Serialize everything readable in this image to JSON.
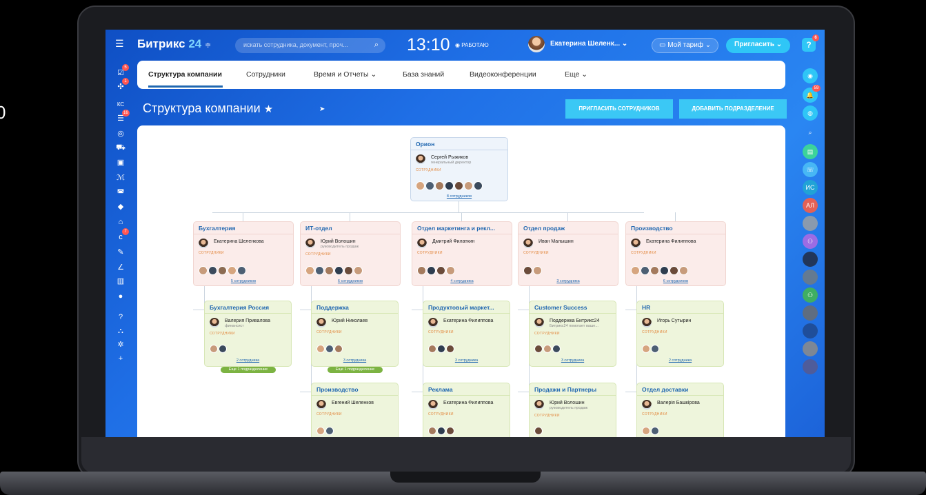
{
  "edge_char": "0",
  "topbar": {
    "logo_name": "Битрикс",
    "logo_num": "24",
    "logo_suffix": "≑",
    "search_placeholder": "искать сотрудника, документ, проч...",
    "time": "13:10",
    "work_status": "◉ РАБОТАЮ",
    "user_name": "Екатерина Шеленк... ⌄",
    "tariff_label": "Мой тариф",
    "invite_label": "Пригласить",
    "help_label": "?",
    "help_badge": "6"
  },
  "left_sidebar": {
    "items": [
      {
        "icon": "checkbox-icon",
        "glyph": "☑",
        "badge": "5"
      },
      {
        "icon": "chat-icon",
        "glyph": "✣",
        "badge": "1"
      },
      {
        "icon": "kc-icon",
        "glyph": "КС",
        "badge": ""
      },
      {
        "icon": "filter-icon",
        "glyph": "☰",
        "badge": "16"
      },
      {
        "icon": "target-icon",
        "glyph": "◎",
        "badge": ""
      },
      {
        "icon": "cart-icon",
        "glyph": "⛟",
        "badge": ""
      },
      {
        "icon": "contacts-icon",
        "glyph": "▣",
        "badge": ""
      },
      {
        "icon": "sites-icon",
        "glyph": "ℳ",
        "badge": ""
      },
      {
        "icon": "robot-icon",
        "glyph": "◚",
        "badge": ""
      },
      {
        "icon": "box-icon",
        "glyph": "◆",
        "badge": ""
      },
      {
        "icon": "building-icon",
        "glyph": "⌂",
        "badge": ""
      },
      {
        "icon": "calendar-icon",
        "glyph": "c",
        "badge": "7"
      },
      {
        "icon": "tasks-icon",
        "glyph": "✎",
        "badge": ""
      },
      {
        "icon": "sign-icon",
        "glyph": "∠",
        "badge": ""
      },
      {
        "icon": "analytics-icon",
        "glyph": "▥",
        "badge": ""
      },
      {
        "icon": "more-icon",
        "glyph": "●",
        "badge": ""
      },
      {
        "icon": "question-icon",
        "glyph": "?",
        "badge": ""
      },
      {
        "icon": "structure-icon",
        "glyph": "⛬",
        "badge": ""
      },
      {
        "icon": "settings-icon",
        "glyph": "✲",
        "badge": ""
      },
      {
        "icon": "plus-icon",
        "glyph": "+",
        "badge": ""
      }
    ]
  },
  "right_sidebar": {
    "items": [
      {
        "icon": "copilot-icon",
        "glyph": "◉",
        "badge": "",
        "color": "#2fc6f6"
      },
      {
        "icon": "bell-icon",
        "glyph": "🔔",
        "badge": "59",
        "color": "#2fc6f6"
      },
      {
        "icon": "chat-bubble-icon",
        "glyph": "◍",
        "badge": "",
        "color": "#2fc6f6"
      },
      {
        "icon": "search-icon",
        "glyph": "⌕",
        "badge": "",
        "color": "transparent"
      },
      {
        "icon": "green-chat-icon",
        "glyph": "▤",
        "badge": "",
        "color": "#3cd39b"
      },
      {
        "icon": "openlines-icon",
        "glyph": "☏",
        "badge": "",
        "color": "#47b7f5"
      },
      {
        "icon": "user-is-icon",
        "glyph": "ИС",
        "badge": "",
        "color": "#21a3d6"
      },
      {
        "icon": "user-al-icon",
        "glyph": "АЛ",
        "badge": "",
        "color": "#e36156"
      },
      {
        "icon": "avatar-1-icon",
        "glyph": "",
        "badge": "",
        "color": "#8a9aae"
      },
      {
        "icon": "group-icon",
        "glyph": "⚇",
        "badge": "",
        "color": "#9b6ce4"
      },
      {
        "icon": "avatar-2-icon",
        "glyph": "",
        "badge": "",
        "color": "#223659"
      },
      {
        "icon": "avatar-3-icon",
        "glyph": "",
        "badge": "",
        "color": "#647a91"
      },
      {
        "icon": "group-2-icon",
        "glyph": "⚇",
        "badge": "",
        "color": "#3fae62"
      },
      {
        "icon": "avatar-4-icon",
        "glyph": "",
        "badge": "",
        "color": "#5f6d80"
      },
      {
        "icon": "avatar-5-icon",
        "glyph": "",
        "badge": "",
        "color": "#1f4e9a"
      },
      {
        "icon": "avatar-6-icon",
        "glyph": "",
        "badge": "",
        "color": "#7d8795"
      },
      {
        "icon": "avatar-7-icon",
        "glyph": "",
        "badge": "",
        "color": "#4f5c9a"
      }
    ]
  },
  "nav": {
    "tabs": [
      {
        "label": "Структура компании"
      },
      {
        "label": "Сотрудники"
      },
      {
        "label": "Время и Отчеты ⌄"
      },
      {
        "label": "База знаний"
      },
      {
        "label": "Видеоконференции"
      },
      {
        "label": "Еще ⌄"
      }
    ]
  },
  "page": {
    "title": "Структура компании",
    "star": "★",
    "invite_button": "ПРИГЛАСИТЬ СОТРУДНИКОВ",
    "add_button": "ДОБАВИТЬ ПОДРАЗДЕЛЕНИЕ"
  },
  "org": {
    "employees_label": "СОТРУДНИКИ",
    "root": {
      "title": "Орион",
      "head": "Сергей Рыжиков",
      "role": "генеральный директор",
      "count": "8 сотрудников",
      "avatars": 7
    },
    "departments": [
      {
        "title": "Бухгалтерия",
        "head": "Екатерина Шеленкова",
        "role": "",
        "count": "5 сотрудников",
        "avatars": 5
      },
      {
        "title": "ИТ-отдел",
        "head": "Юрий Волошин",
        "role": "руководитель продаж",
        "count": "6 сотрудников",
        "avatars": 6
      },
      {
        "title": "Отдел маркетинга и рекл...",
        "head": "Дмитрий Филаткин",
        "role": "",
        "count": "4 сотрудника",
        "avatars": 4
      },
      {
        "title": "Отдел продаж",
        "head": "Иван Малышин",
        "role": "",
        "count": "3 сотрудника",
        "avatars": 2
      },
      {
        "title": "Производство",
        "head": "Екатерина Филиппова",
        "role": "",
        "count": "6 сотрудников",
        "avatars": 6
      }
    ],
    "subs_row1": [
      {
        "title": "Бухгалтерия Россия",
        "head": "Валерия Привалова",
        "role": "финансист",
        "count": "2 сотрудника",
        "avatars": 2,
        "more": "Еще 1 подразделение"
      },
      {
        "title": "Поддержка",
        "head": "Юрий Николаев",
        "role": "",
        "count": "3 сотрудника",
        "avatars": 3,
        "more": "Еще 1 подразделение"
      },
      {
        "title": "Продуктовый маркет...",
        "head": "Екатерина Филиппова",
        "role": "",
        "count": "3 сотрудника",
        "avatars": 3,
        "more": ""
      },
      {
        "title": "Customer Success",
        "head": "Поддержка Битрикс24",
        "role": "Битрикс24 помогает ваше...",
        "count": "3 сотрудника",
        "avatars": 3,
        "more": ""
      },
      {
        "title": "HR",
        "head": "Игорь Сутырин",
        "role": "",
        "count": "2 сотрудника",
        "avatars": 2,
        "more": ""
      }
    ],
    "subs_row2": [
      {
        "title": "Производство",
        "head": "Евгений Шеленков",
        "role": "",
        "avatars": 2
      },
      {
        "title": "Реклама",
        "head": "Екатерина Филиппова",
        "role": "",
        "avatars": 3
      },
      {
        "title": "Продажи и Партнеры",
        "head": "Юрий Волошин",
        "role": "руководитель продаж",
        "avatars": 1
      },
      {
        "title": "Отдел доставки",
        "head": "Валерія Башкірова",
        "role": "",
        "avatars": 2
      }
    ]
  },
  "colors": {
    "accent": "#2067b0",
    "cta": "#3bc8f5",
    "badge": "#ff5752",
    "employees_label": "#e2883f",
    "more_badge": "#7cb342"
  }
}
